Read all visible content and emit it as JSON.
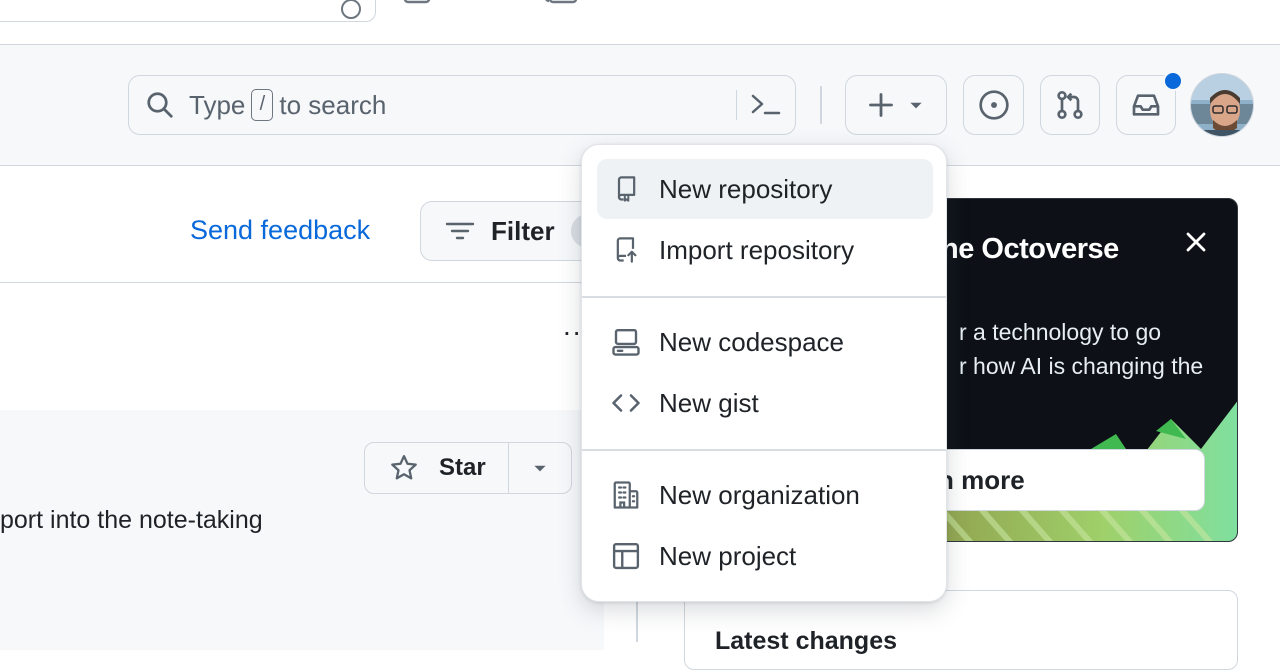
{
  "header": {
    "search": {
      "prefix": "Type",
      "key": "/",
      "suffix": "to search"
    }
  },
  "page": {
    "feedback_label": "Send feedback",
    "filter_label": "Filter",
    "star_label": "Star",
    "description": "port into the note-taking",
    "more_menu": "..."
  },
  "promo": {
    "title": "he Octoverse",
    "line1": "r a technology to go",
    "line2": "r how AI is changing the",
    "line3": ".",
    "button_label": "n more"
  },
  "latest": {
    "title": "Latest changes"
  },
  "create_menu": {
    "items": [
      {
        "label": "New repository",
        "icon": "repo-icon"
      },
      {
        "label": "Import repository",
        "icon": "repo-push-icon"
      },
      {
        "label": "New codespace",
        "icon": "codespaces-icon"
      },
      {
        "label": "New gist",
        "icon": "code-icon"
      },
      {
        "label": "New organization",
        "icon": "organization-icon"
      },
      {
        "label": "New project",
        "icon": "table-icon"
      }
    ]
  },
  "colors": {
    "accent": "#0969da",
    "header_bg": "#f6f8fa",
    "notification": "#0969da"
  }
}
